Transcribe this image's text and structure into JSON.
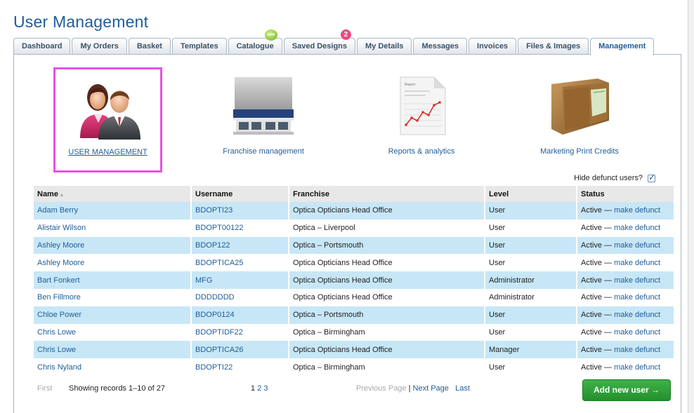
{
  "page": {
    "title": "User Management"
  },
  "tabs": [
    {
      "label": "Dashboard"
    },
    {
      "label": "My Orders"
    },
    {
      "label": "Basket"
    },
    {
      "label": "Templates"
    },
    {
      "label": "Catalogue",
      "badge": "new"
    },
    {
      "label": "Saved Designs",
      "badge_count": "2"
    },
    {
      "label": "My Details"
    },
    {
      "label": "Messages"
    },
    {
      "label": "Invoices"
    },
    {
      "label": "Files & Images"
    },
    {
      "label": "Management",
      "active": true
    }
  ],
  "tiles": {
    "user_management": "USER MANAGEMENT",
    "franchise": "Franchise management",
    "reports": "Reports & analytics",
    "report_doc_title": "Report",
    "marketing": "Marketing Print Credits"
  },
  "filter": {
    "hide_defunct_label": "Hide defunct users?",
    "hide_defunct_checked": true
  },
  "table": {
    "headers": {
      "name": "Name",
      "username": "Username",
      "franchise": "Franchise",
      "level": "Level",
      "status": "Status"
    },
    "rows": [
      {
        "name": "Adam Berry",
        "username": "BDOPTI23",
        "franchise": "Optica Opticians Head Office",
        "level": "User",
        "status": "Active —",
        "action": "make defunct"
      },
      {
        "name": "Alistair Wilson",
        "username": "BDOPT00122",
        "franchise": "Optica – Liverpool",
        "level": "User",
        "status": "Active —",
        "action": "make defunct"
      },
      {
        "name": "Ashley Moore",
        "username": "BDOP122",
        "franchise": "Optica – Portsmouth",
        "level": "User",
        "status": "Active —",
        "action": "make defunct"
      },
      {
        "name": "Ashley Moore",
        "username": "BDOPTICA25",
        "franchise": "Optica Opticians Head Office",
        "level": "User",
        "status": "Active —",
        "action": "make defunct"
      },
      {
        "name": "Bart Fonkert",
        "username": "MFG",
        "franchise": "Optica Opticians Head Office",
        "level": "Administrator",
        "status": "Active —",
        "action": "make defunct"
      },
      {
        "name": "Ben Fillmore",
        "username": "DDDDDDD",
        "franchise": "Optica Opticians Head Office",
        "level": "Administrator",
        "status": "Active —",
        "action": "make defunct"
      },
      {
        "name": "Chloe Power",
        "username": "BDOP0124",
        "franchise": "Optica – Portsmouth",
        "level": "User",
        "status": "Active —",
        "action": "make defunct"
      },
      {
        "name": "Chris Lowe",
        "username": "BDOPTIDF22",
        "franchise": "Optica – Birmingham",
        "level": "User",
        "status": "Active —",
        "action": "make defunct"
      },
      {
        "name": "Chris Lowe",
        "username": "BDOPTICA26",
        "franchise": "Optica Opticians Head Office",
        "level": "Manager",
        "status": "Active —",
        "action": "make defunct"
      },
      {
        "name": "Chris Nyland",
        "username": "BDOPTI22",
        "franchise": "Optica – Birmingham",
        "level": "User",
        "status": "Active —",
        "action": "make defunct"
      }
    ]
  },
  "pagination": {
    "first": "First",
    "showing": "Showing records 1–10 of 27",
    "current_page": "1",
    "pages": [
      "2",
      "3"
    ],
    "previous": "Previous Page",
    "separator": "|",
    "next": "Next Page",
    "last": "Last"
  },
  "actions": {
    "add_user": "Add new user →"
  },
  "colors": {
    "accent": "#1f5d99",
    "row_highlight": "#c7e7f7",
    "selection": "#e353e3",
    "button": "#2b9a33"
  },
  "icons": [
    "users-icon",
    "storefront-icon",
    "report-chart-icon",
    "wallet-icon",
    "checkbox-checked-icon",
    "sort-asc-icon"
  ]
}
